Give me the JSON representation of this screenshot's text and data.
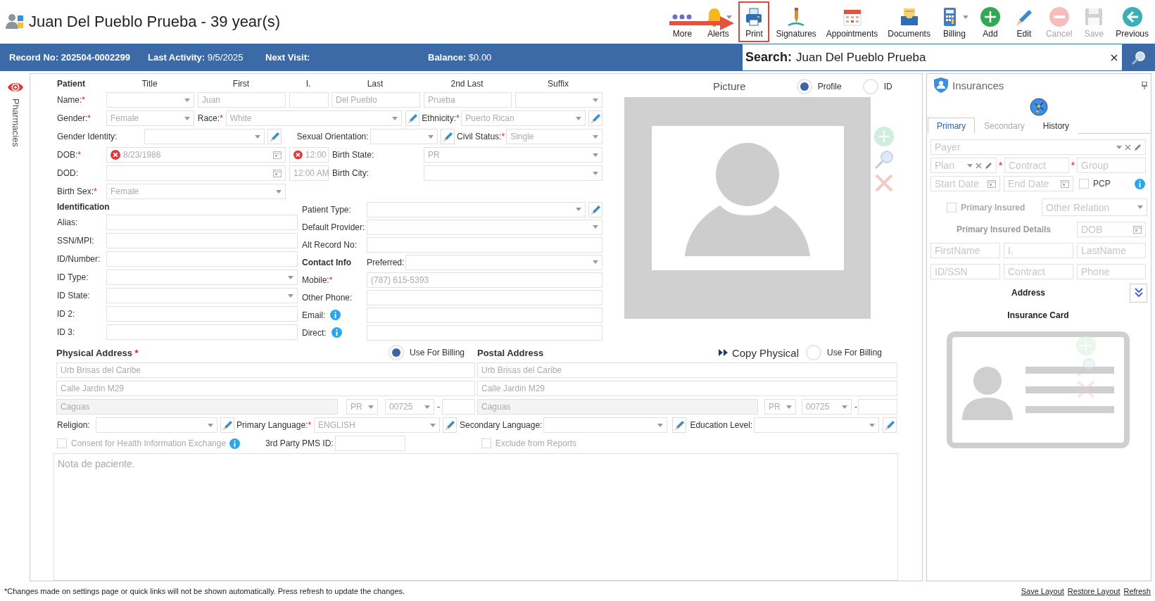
{
  "header": {
    "title": "Juan Del Pueblo Prueba - 39 year(s)",
    "toolbar": [
      {
        "kind": "more",
        "label": "More",
        "menu": false,
        "highlighted": false,
        "disabled": false
      },
      {
        "kind": "alerts",
        "label": "Alerts",
        "menu": true,
        "highlighted": false,
        "disabled": false
      },
      {
        "kind": "print",
        "label": "Print",
        "menu": false,
        "highlighted": true,
        "disabled": false
      },
      {
        "kind": "signatures",
        "label": "Signatures",
        "menu": false,
        "highlighted": false,
        "disabled": false
      },
      {
        "kind": "appointments",
        "label": "Appointments",
        "menu": false,
        "highlighted": false,
        "disabled": false
      },
      {
        "kind": "documents",
        "label": "Documents",
        "menu": false,
        "highlighted": false,
        "disabled": false
      },
      {
        "kind": "billing",
        "label": "Billing",
        "menu": true,
        "highlighted": false,
        "disabled": false
      },
      {
        "kind": "add",
        "label": "Add",
        "menu": false,
        "highlighted": false,
        "disabled": false
      },
      {
        "kind": "edit",
        "label": "Edit",
        "menu": false,
        "highlighted": false,
        "disabled": false
      },
      {
        "kind": "cancel",
        "label": "Cancel",
        "menu": false,
        "highlighted": false,
        "disabled": true
      },
      {
        "kind": "save",
        "label": "Save",
        "menu": false,
        "highlighted": false,
        "disabled": true
      },
      {
        "kind": "previous",
        "label": "Previous",
        "menu": false,
        "highlighted": false,
        "disabled": false
      }
    ]
  },
  "info_bar": {
    "record": "Record No: 202504-0002299",
    "last_activity": "**Last Activity:** 9/5/2025",
    "next_visit": "Next Visit:",
    "balance": "**Balance:** $0.00",
    "search_label": "Search:",
    "search_value": "Juan Del Pueblo Prueba"
  },
  "side_tab": {
    "label": "Pharmacies"
  },
  "patient": {
    "heading": "Patient",
    "columns": [
      "Title",
      "First",
      "I.",
      "Last",
      "2nd Last",
      "Suffix"
    ],
    "name": {
      "label": "Name:",
      "required_mark": "*",
      "parts": [
        {
          "kind": "select"
        },
        {
          "kind": "text",
          "value": "Juan"
        },
        {
          "kind": "text"
        },
        {
          "kind": "text",
          "value": "Del Pueblo"
        },
        {
          "kind": "text",
          "value": "Prueba"
        },
        {
          "kind": "select"
        }
      ]
    },
    "gender": {
      "label": "Gender:",
      "required_mark": "*",
      "value": "Female"
    },
    "race": {
      "label": "Race:",
      "required_mark": "*",
      "value": "White"
    },
    "ethnicity": {
      "label": "Ethnicity:",
      "required_mark": "*",
      "value": "Puerto Rican"
    },
    "gender_identity": {
      "label": "Gender Identity:"
    },
    "sexual_orientation": {
      "label": "Sexual Orientation:"
    },
    "civil_status": {
      "label": "Civil Status:",
      "required_mark": "*",
      "value": "Single"
    },
    "dob": {
      "label": "DOB:",
      "required_mark": "*",
      "value": "8/23/1986",
      "time": "12:00",
      "clearable": true
    },
    "dod": {
      "label": "DOD:",
      "time": "12:00 AM",
      "clearable": false
    },
    "birth_state": {
      "label": "Birth State:",
      "value": "PR"
    },
    "birth_city": {
      "label": "Birth City:"
    },
    "birth_sex": {
      "label": "Birth Sex:",
      "required_mark": "*",
      "value": "Female"
    }
  },
  "identification": {
    "heading": "Identification",
    "fields": [
      {
        "label": "Alias:",
        "kind": "text"
      },
      {
        "label": "SSN/MPI:",
        "kind": "text"
      },
      {
        "label": "ID/Number:",
        "kind": "text"
      },
      {
        "label": "ID Type:",
        "kind": "select"
      },
      {
        "label": "ID State:",
        "kind": "select"
      },
      {
        "label": "ID 2:",
        "kind": "text"
      },
      {
        "label": "ID 3:",
        "kind": "text"
      }
    ]
  },
  "details": [
    {
      "label": "Patient Type:",
      "kind": "select",
      "editable": true
    },
    {
      "label": "Default Provider:",
      "kind": "select"
    },
    {
      "label": "Alt Record No:",
      "kind": "text"
    },
    {
      "heading": "Contact Info",
      "label": "Preferred:",
      "kind": "select"
    },
    {
      "label": "Mobile:",
      "required_mark": "*",
      "kind": "text",
      "value": "(787) 615-5393"
    },
    {
      "label": "Other Phone:",
      "kind": "text"
    },
    {
      "label": "Email:",
      "kind": "text",
      "info": true
    },
    {
      "label": "Direct:",
      "kind": "text",
      "info": true
    }
  ],
  "picture": {
    "title": "Picture",
    "options": [
      {
        "label": "Profile",
        "selected": true
      },
      {
        "label": "ID",
        "selected": false
      }
    ]
  },
  "physical_address": {
    "heading": "Physical Address",
    "required_mark": "*",
    "billing": {
      "label": "Use For Billing",
      "selected": true
    },
    "line1": "Urb Brisas del Caribe",
    "line2": "Calle Jardin M29",
    "city": "Caguas",
    "state": "PR",
    "zip": "00725",
    "separator": "-"
  },
  "postal_address": {
    "heading": "Postal Address",
    "copy_label": "Copy Physical",
    "billing": {
      "label": "Use For Billing",
      "selected": false
    },
    "line1": "Urb Brisas del Caribe",
    "line2": "Calle Jardin M29",
    "city": "Caguas",
    "state": "PR",
    "zip": "00725",
    "separator": "-"
  },
  "demographics": [
    {
      "label": "Religion:"
    },
    {
      "label": "Primary Language:",
      "required_mark": "*",
      "value": "ENGLISH"
    },
    {
      "label": "Secondary Language:"
    },
    {
      "label": "Education Level:"
    }
  ],
  "consent": {
    "label": "Consent for Health Information Exchange",
    "checked": false,
    "disabled": true
  },
  "pms_id": {
    "label": "3rd Party PMS ID:"
  },
  "exclude": {
    "label": "Exclude from Reports",
    "checked": false,
    "disabled": true
  },
  "notes": {
    "placeholder": "Nota de paciente."
  },
  "insurances": {
    "title": "Insurances",
    "tabs": [
      {
        "label": "Primary",
        "selected": true,
        "disabled": false
      },
      {
        "label": "Secondary",
        "selected": false,
        "disabled": true
      },
      {
        "label": "History",
        "selected": false,
        "disabled": false
      }
    ],
    "payer": {
      "placeholder": "Payer"
    },
    "plan": {
      "placeholder": "Plan"
    },
    "contract": {
      "placeholder": "Contract",
      "required_mark": "*"
    },
    "group": {
      "placeholder": "Group",
      "required_mark": "*"
    },
    "start_date": {
      "placeholder": "Start Date"
    },
    "end_date": {
      "placeholder": "End Date"
    },
    "pcp": {
      "label": "PCP",
      "checked": false
    },
    "primary_insured": {
      "label": "Primary Insured",
      "checked": false
    },
    "other_relation": {
      "placeholder": "Other Relation"
    },
    "details_heading": "Primary Insured Details",
    "dob": {
      "placeholder": "DOB"
    },
    "first_name": {
      "placeholder": "FirstName"
    },
    "initial": {
      "placeholder": "I."
    },
    "last_name": {
      "placeholder": "LastName"
    },
    "id_ssn": {
      "placeholder": "ID/SSN"
    },
    "insured_contract": {
      "placeholder": "Contract"
    },
    "phone": {
      "placeholder": "Phone"
    },
    "address_heading": "Address",
    "card_heading": "Insurance Card"
  },
  "footer": {
    "note": "*Changes made on settings page or quick links will not be shown automatically. Press refresh to update the changes.",
    "links": [
      "Save Layout",
      "Restore Layout",
      "Refresh"
    ]
  }
}
